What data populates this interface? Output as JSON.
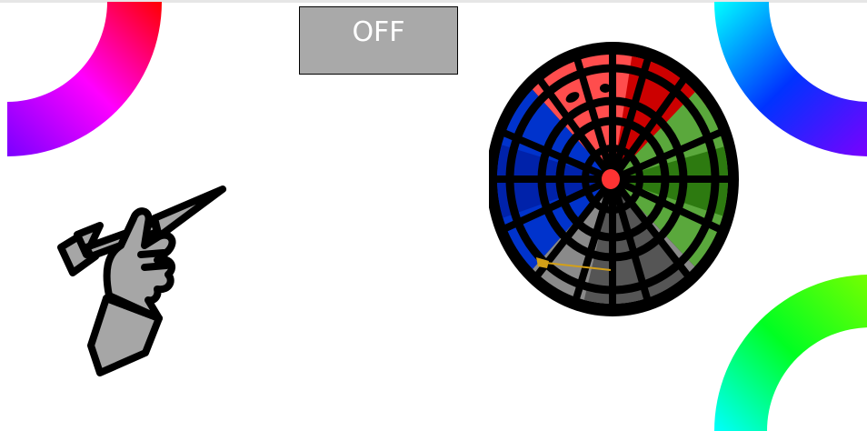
{
  "toggle": {
    "label": "OFF",
    "state": "off"
  },
  "dartboard": {
    "sector_colors": {
      "top": "#ff4d4d",
      "top_dark": "#cc0000",
      "right": "#5aa83c",
      "right_dark": "#2d7a10",
      "left": "#0033cc",
      "left_dark": "#0022aa",
      "bottom": "#8a8a8a",
      "bottom_dark": "#555555",
      "bullseye": "#ff3333"
    },
    "dart_color": "#d4a017"
  },
  "thrower": {
    "fill_color": "#a6a6a6",
    "outline_color": "#000000"
  }
}
